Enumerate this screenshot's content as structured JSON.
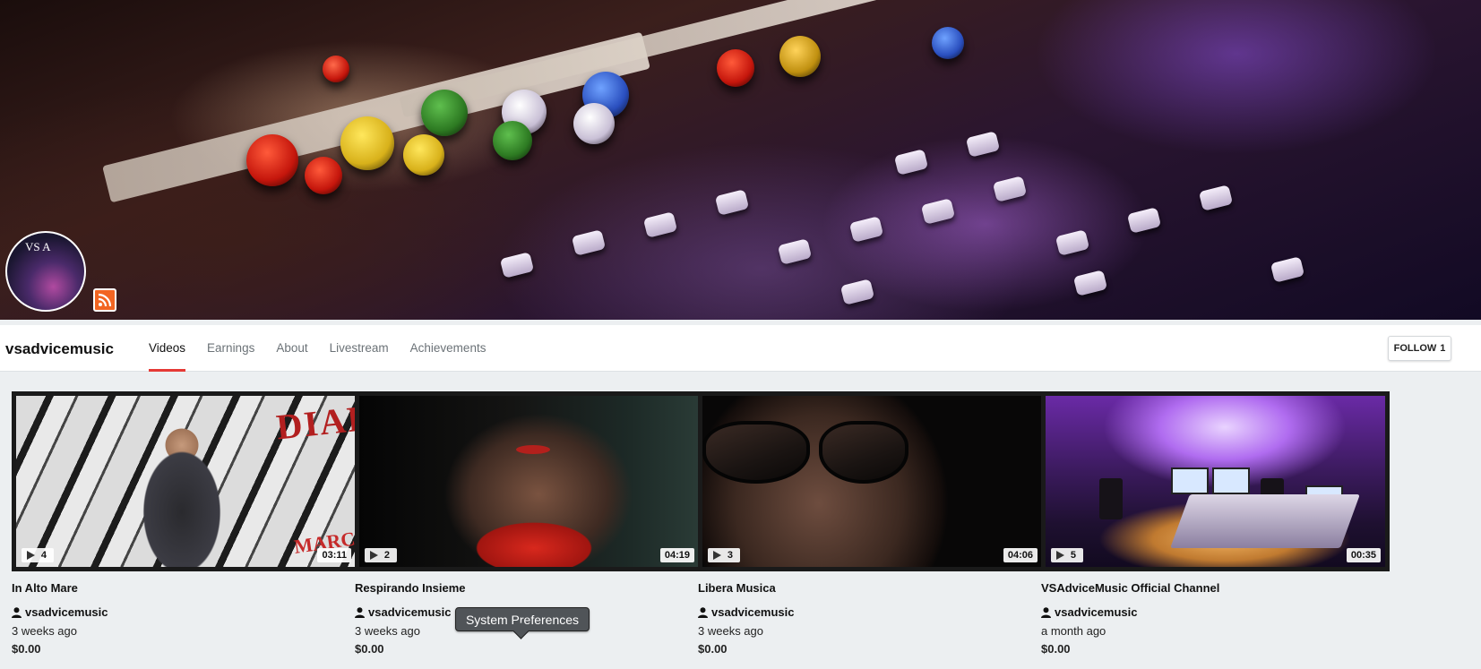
{
  "channel": {
    "name": "vsadvicemusic",
    "avatar_text": "VS A"
  },
  "nav": {
    "tabs": [
      {
        "label": "Videos",
        "active": true
      },
      {
        "label": "Earnings",
        "active": false
      },
      {
        "label": "About",
        "active": false
      },
      {
        "label": "Livestream",
        "active": false
      },
      {
        "label": "Achievements",
        "active": false
      }
    ],
    "follow_label": "FOLLOW",
    "follow_count": "1"
  },
  "videos": [
    {
      "title": "In Alto Mare",
      "count": "4",
      "duration": "03:11",
      "author": "vsadvicemusic",
      "ago": "3 weeks ago",
      "price": "$0.00",
      "thumb_text": [
        "DIABOLIK",
        "MARCO"
      ]
    },
    {
      "title": "Respirando Insieme",
      "count": "2",
      "duration": "04:19",
      "author": "vsadvicemusic",
      "ago": "3 weeks ago",
      "price": "$0.00"
    },
    {
      "title": "Libera Musica",
      "count": "3",
      "duration": "04:06",
      "author": "vsadvicemusic",
      "ago": "3 weeks ago",
      "price": "$0.00"
    },
    {
      "title": "VSAdviceMusic Official Channel",
      "count": "5",
      "duration": "00:35",
      "author": "vsadvicemusic",
      "ago": "a month ago",
      "price": "$0.00"
    }
  ],
  "tooltip": {
    "text": "System Preferences"
  },
  "colors": {
    "accent": "#e53935",
    "rss": "#f26522"
  },
  "icons": {
    "rss": "rss-icon",
    "play": "play-icon",
    "user": "user-icon"
  }
}
